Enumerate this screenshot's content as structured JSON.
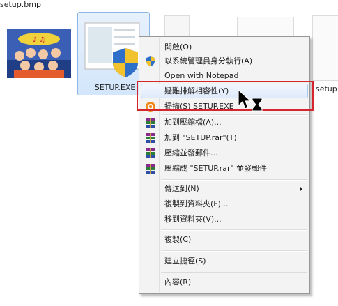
{
  "files": {
    "bmp_label": "setup.bmp",
    "exe_label": "SETUP.EXE",
    "right_label": "setup"
  },
  "menu": {
    "items": [
      {
        "label": "開啟(O)"
      },
      {
        "label": "以系統管理員身分執行(A)"
      },
      {
        "label": "Open with Notepad"
      },
      {
        "label": "疑難排解相容性(Y)"
      },
      {
        "label": "掃描(S) SETUP.EXE"
      },
      {
        "label": "加到壓縮檔(A)..."
      },
      {
        "label": "加到 \"SETUP.rar\"(T)"
      },
      {
        "label": "壓縮並發郵件..."
      },
      {
        "label": "壓縮成 \"SETUP.rar\" 並發郵件"
      },
      {
        "label": "傳送到(N)"
      },
      {
        "label": "複製到資料夾(F)..."
      },
      {
        "label": "移到資料夾(V)..."
      },
      {
        "label": "複製(C)"
      },
      {
        "label": "建立捷徑(S)"
      },
      {
        "label": "內容(R)"
      }
    ]
  },
  "icons": {
    "shield": "uac-shield-icon",
    "scan": "antivirus-scan-icon",
    "winrar": "winrar-icon"
  },
  "colors": {
    "highlight_box": "#d3262d",
    "hover_border": "#a8c8ee"
  }
}
